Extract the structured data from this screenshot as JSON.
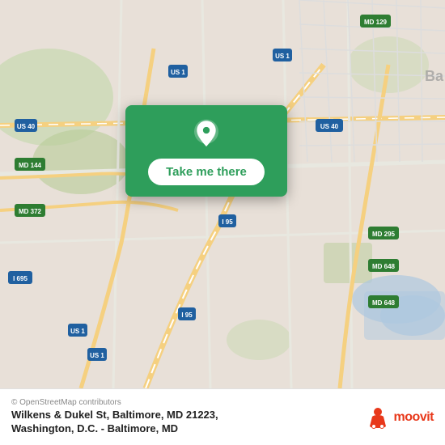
{
  "map": {
    "background_color": "#e8e0d8"
  },
  "card": {
    "button_label": "Take me there",
    "background_color": "#2e9e5b"
  },
  "footer": {
    "copyright": "© OpenStreetMap contributors",
    "address": "Wilkens & Dukel St, Baltimore, MD 21223,",
    "subtitle": "Washington, D.C. - Baltimore, MD",
    "logo_name": "moovit"
  }
}
